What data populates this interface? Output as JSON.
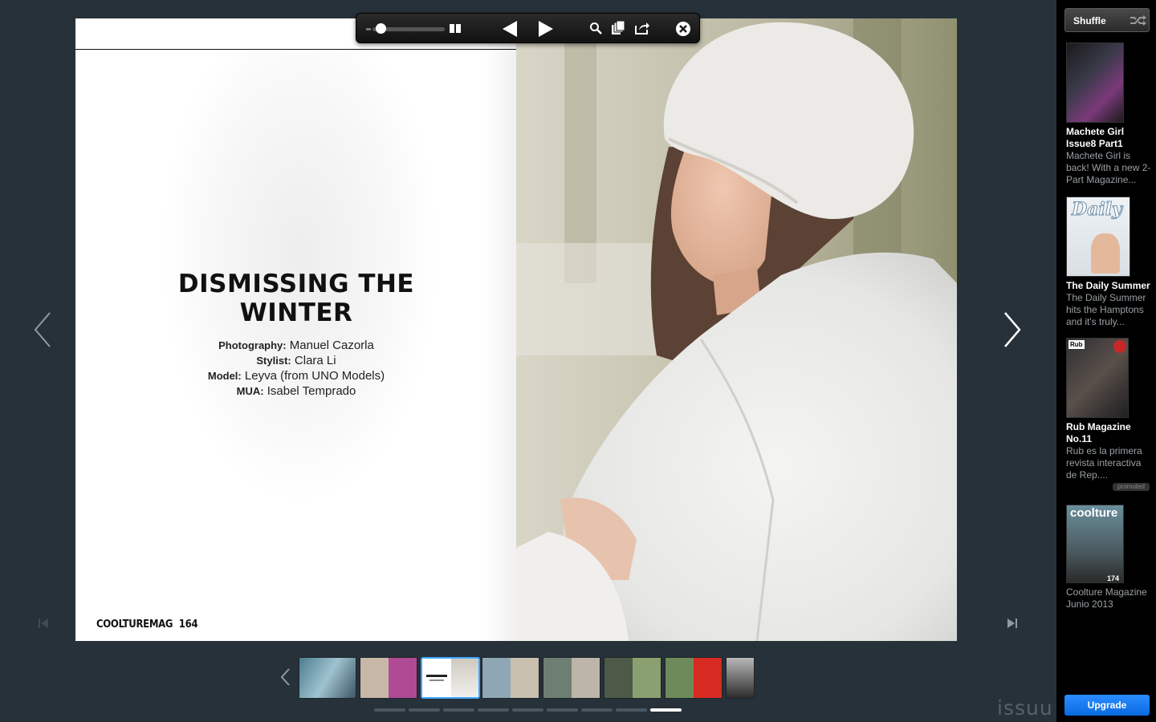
{
  "app": {
    "brand": "issuu",
    "accent_color": "#1a7cf3"
  },
  "toolbar": {
    "zoom_level": 0,
    "icons": [
      "zoom-min-icon",
      "two-page-view-icon",
      "previous-page-icon",
      "next-page-icon",
      "search-icon",
      "library-icon",
      "share-icon",
      "close-icon"
    ]
  },
  "spread": {
    "left_page": {
      "title": "DISMISSING THE WINTER",
      "credits": [
        {
          "label": "Photography:",
          "value": "Manuel Cazorla"
        },
        {
          "label": "Stylist:",
          "value": "Clara Li"
        },
        {
          "label": "Model:",
          "value": "Leyva (from UNO Models)"
        },
        {
          "label": "MUA:",
          "value": "Isabel Temprado"
        }
      ],
      "folio_brand": "COOLTUREMAG",
      "page_number": "164"
    }
  },
  "thumbnails": {
    "count_spreads": 8,
    "active_index": 2,
    "page_dots": 9,
    "current_dot": 8
  },
  "sidebar": {
    "shuffle_label": "Shuffle",
    "recommendations": [
      {
        "title": "Machete Girl Issue8 Part1",
        "description": "Machete Girl is back! With a new 2-Part Magazine..."
      },
      {
        "title": "The Daily Summer",
        "description": "The Daily Summer hits the Hamptons and it's truly..."
      },
      {
        "title": "Rub Magazine No.11",
        "description": "Rub es la primera revista interactiva de Rep...."
      },
      {
        "title": "",
        "description": "Coolture Magazine Junio 2013"
      }
    ],
    "promoted_label": "promoted",
    "upgrade_label": "Upgrade",
    "cover_texts": {
      "daily": "Daily",
      "rub": "Rub",
      "coolture": "coolture",
      "coolture_issue": "174"
    }
  }
}
